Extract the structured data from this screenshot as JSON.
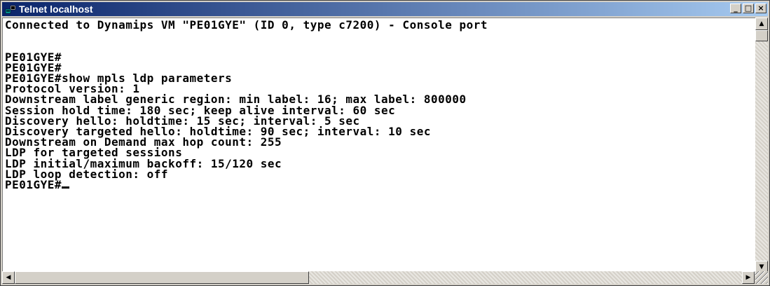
{
  "window": {
    "title": "Telnet localhost",
    "controls": {
      "minimize": "_",
      "maximize": "□",
      "close": "×"
    }
  },
  "console": {
    "lines": [
      "Connected to Dynamips VM \"PE01GYE\" (ID 0, type c7200) - Console port",
      "",
      "",
      "PE01GYE#",
      "PE01GYE#",
      "PE01GYE#show mpls ldp parameters",
      "Protocol version: 1",
      "Downstream label generic region: min label: 16; max label: 800000",
      "Session hold time: 180 sec; keep alive interval: 60 sec",
      "Discovery hello: holdtime: 15 sec; interval: 5 sec",
      "Discovery targeted hello: holdtime: 90 sec; interval: 10 sec",
      "Downstream on Demand max hop count: 255",
      "LDP for targeted sessions",
      "LDP initial/maximum backoff: 15/120 sec",
      "LDP loop detection: off"
    ],
    "prompt": "PE01GYE#"
  },
  "scrollbars": {
    "up_arrow": "▲",
    "down_arrow": "▼",
    "left_arrow": "◀",
    "right_arrow": "▶"
  },
  "icons": {
    "title": "telnet-window-icon"
  }
}
